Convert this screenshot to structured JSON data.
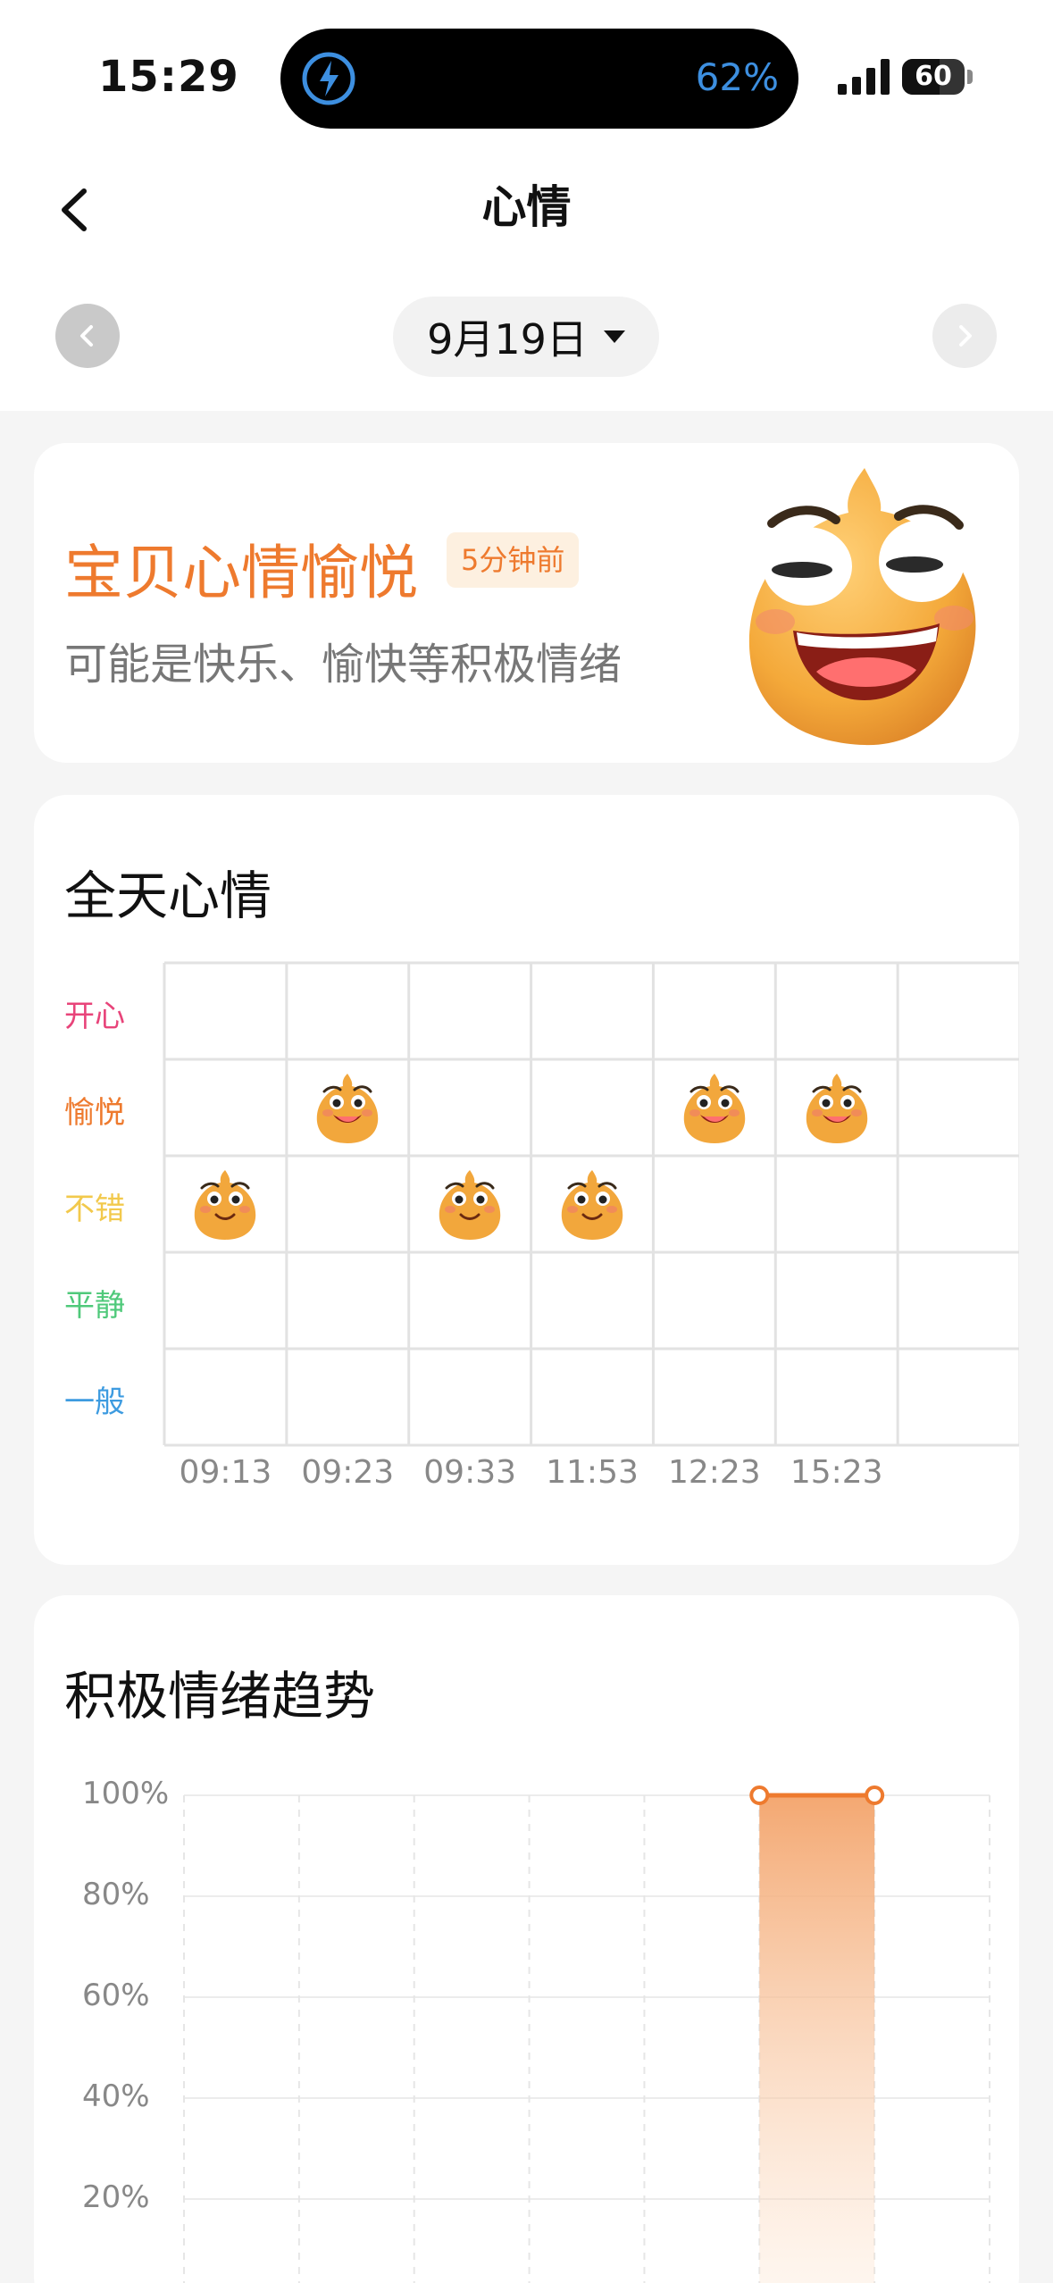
{
  "status_bar": {
    "time": "15:29",
    "battery_charge_percent": "62%",
    "battery_level": "60",
    "battery_level_fraction": 0.6,
    "accent_color": "#3d8fe0"
  },
  "header": {
    "title": "心情",
    "date": "9月19日",
    "back_icon": "chevron-left-icon",
    "prev_icon": "chevron-left-icon",
    "next_icon": "chevron-right-icon"
  },
  "mood_summary": {
    "title": "宝贝心情愉悦",
    "badge": "5分钟前",
    "description": "可能是快乐、愉快等积极情绪",
    "accent_color": "#ee7a2e"
  },
  "daily_mood": {
    "title": "全天心情",
    "levels": [
      {
        "label": "开心",
        "color": "#e8447a"
      },
      {
        "label": "愉悦",
        "color": "#ee7a2e"
      },
      {
        "label": "不错",
        "color": "#f2c94c"
      },
      {
        "label": "平静",
        "color": "#4fc97a"
      },
      {
        "label": "一般",
        "color": "#3d9be0"
      }
    ],
    "times": [
      "09:13",
      "09:23",
      "09:33",
      "11:53",
      "12:23",
      "15:23"
    ],
    "entries": [
      {
        "time": "09:13",
        "level": "不错"
      },
      {
        "time": "09:23",
        "level": "愉悦"
      },
      {
        "time": "09:33",
        "level": "不错"
      },
      {
        "time": "11:53",
        "level": "不错"
      },
      {
        "time": "12:23",
        "level": "愉悦"
      },
      {
        "time": "15:23",
        "level": "愉悦"
      }
    ]
  },
  "trend": {
    "title": "积极情绪趋势",
    "y_labels": [
      "100%",
      "80%",
      "60%",
      "40%",
      "20%"
    ]
  },
  "chart_data": {
    "type": "area",
    "title": "积极情绪趋势",
    "ylim": [
      0,
      100
    ],
    "y_ticks": [
      "100%",
      "80%",
      "60%",
      "40%",
      "20%"
    ],
    "grid": true,
    "series": [
      {
        "x_index_range": [
          5,
          6
        ],
        "value": 100,
        "color": "#ee7a2e"
      }
    ]
  }
}
